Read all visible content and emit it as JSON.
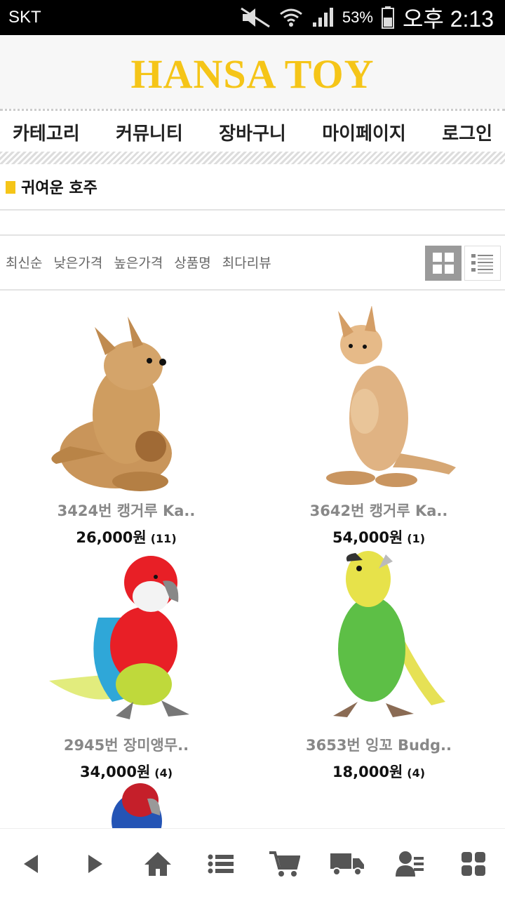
{
  "status": {
    "carrier": "SKT",
    "battery": "53%",
    "time": "오후 2:13"
  },
  "header": {
    "logo": "HANSA TOY"
  },
  "nav": [
    "카테고리",
    "커뮤니티",
    "장바구니",
    "마이페이지",
    "로그인"
  ],
  "category": {
    "title": "귀여운 호주"
  },
  "sort": [
    "최신순",
    "낮은가격",
    "높은가격",
    "상품명",
    "최다리뷰"
  ],
  "products": [
    {
      "name": "3424번 캥거루 Ka..",
      "price": "26,000원",
      "count": "(11)",
      "icon": "kangaroo-plush"
    },
    {
      "name": "3642번 캥거루 Ka..",
      "price": "54,000원",
      "count": "(1)",
      "icon": "kangaroo-plush"
    },
    {
      "name": "2945번 장미앵무..",
      "price": "34,000원",
      "count": "(4)",
      "icon": "parrot-plush"
    },
    {
      "name": "3653번 잉꼬 Budg..",
      "price": "18,000원",
      "count": "(4)",
      "icon": "budgie-plush"
    }
  ],
  "bottom_nav": [
    "back-icon",
    "forward-icon",
    "home-icon",
    "menu-list-icon",
    "cart-icon",
    "delivery-truck-icon",
    "my-account-icon",
    "apps-grid-icon"
  ]
}
